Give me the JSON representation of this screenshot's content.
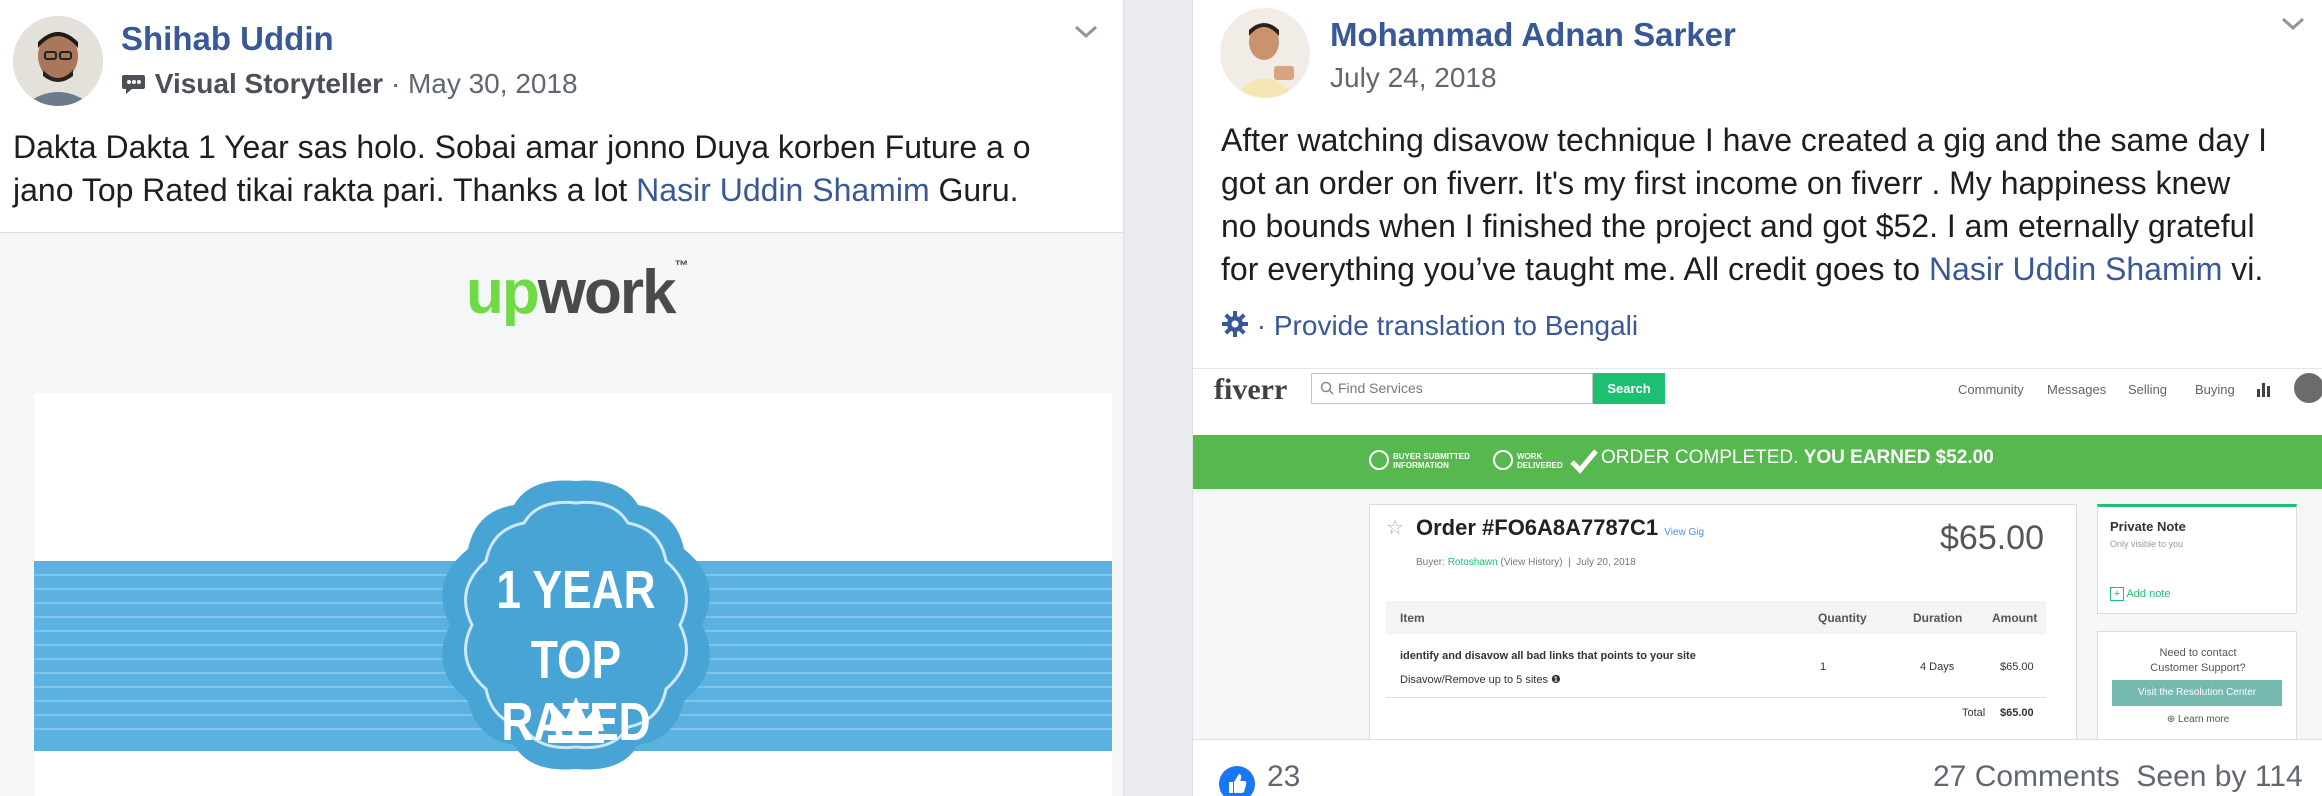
{
  "left_post": {
    "author": "Shihab Uddin",
    "badge_icon": "chat-bubble-icon",
    "badge_label": "Visual Storyteller",
    "separator": "·",
    "date": "May 30, 2018",
    "text_line1": "Dakta Dakta 1 Year sas holo. Sobai amar jonno Duya korben Future a o",
    "text_line2_pre": "jano Top Rated tikai rakta pari. Thanks a lot ",
    "mention": "Nasir Uddin Shamim",
    "text_line2_post": " Guru.",
    "image": {
      "logo_up": "up",
      "logo_work": "work",
      "logo_tm": "™",
      "badge_line1": "1 YEAR",
      "badge_line2": "TOP RATED",
      "ribbon_color": "#5bb2e0",
      "badge_color": "#49a4d6"
    }
  },
  "right_post": {
    "author": "Mohammad Adnan Sarker",
    "date": "July 24, 2018",
    "lines": [
      "After watching disavow technique I have created a gig and the same day I",
      "got an order on fiverr. It's my first income on fiverr . My happiness knew",
      "no bounds when I finished the project and got $52. I am eternally grateful"
    ],
    "line4_pre": "for everything you’ve taught me. All credit goes to ",
    "mention": "Nasir Uddin Shamim",
    "line4_post": " vi.",
    "translate_icon": "gear-icon",
    "translate_link": "· Provide translation to Bengali",
    "footer": {
      "likes": "23",
      "comments_seen": "27 Comments  Seen by 114"
    }
  },
  "fiverr": {
    "logo": "fiverr",
    "search_placeholder": "Find Services",
    "search_button": "Search",
    "nav": [
      "Community",
      "Messages",
      "Selling",
      "Buying"
    ],
    "step1": [
      "BUYER SUBMITTED",
      "INFORMATION"
    ],
    "step2": [
      "WORK",
      "DELIVERED"
    ],
    "completed": "ORDER COMPLETED.",
    "earned": "YOU EARNED $52.00",
    "order_title": "Order #FO6A8A7787C1",
    "view_gig": "View Gig",
    "buyer_label": "Buyer:",
    "buyer_name": "Rotoshawn",
    "view_history": "(View History)",
    "order_date": "July 20, 2018",
    "price": "$65.00",
    "columns": [
      "Item",
      "Quantity",
      "Duration",
      "Amount"
    ],
    "item_title": "identify and disavow all bad links that points to your site",
    "item_sub": "Disavow/Remove up to 5 sites",
    "quantity": "1",
    "duration": "4 Days",
    "amount": "$65.00",
    "total_label": "Total",
    "total": "$65.00",
    "private_note_title": "Private Note",
    "private_note_sub": "Only visible to you",
    "add_note": "Add note",
    "support_line1": "Need to contact",
    "support_line2": "Customer Support?",
    "resolution_button": "Visit the Resolution Center",
    "learn_more": "Learn more",
    "brand_color": "#1dbf73",
    "banner_color": "#56b84e"
  }
}
